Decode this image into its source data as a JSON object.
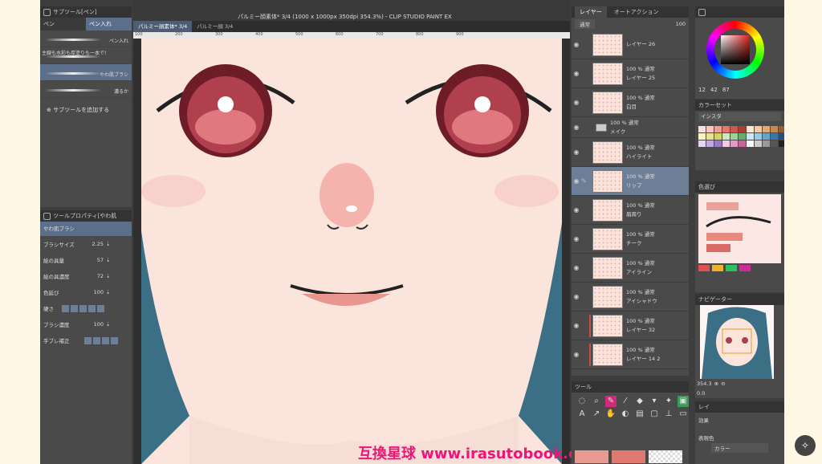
{
  "subtool": {
    "header": "サブツール[ペン]",
    "tabs": [
      "ペン",
      "ペン入れ"
    ],
    "brushes": [
      {
        "label": "ペン入れ"
      },
      {
        "label": "主線も水彩も厚塗りも一本で!"
      },
      {
        "label": "やわ肌ブラシ"
      },
      {
        "label": "濃るか"
      }
    ],
    "add": "サブツールを追加する"
  },
  "toolprop": {
    "header": "ツールプロパティ[やわ肌",
    "brush": "やわ肌ブラシ",
    "rows": [
      {
        "label": "ブラシサイズ",
        "value": "2.25"
      },
      {
        "label": "絵の具量",
        "value": "57"
      },
      {
        "label": "絵の具濃度",
        "value": "72"
      },
      {
        "label": "色延び",
        "value": "100"
      },
      {
        "label": "硬さ",
        "value": ""
      },
      {
        "label": "ブラシ濃度",
        "value": "100"
      },
      {
        "label": "手ブレ補正",
        "value": ""
      }
    ]
  },
  "canvas": {
    "title": "パルミー顔素体* 3/4 (1000 x 1000px 350dpi 354.3%) - CLIP STUDIO PAINT EX",
    "tabs": [
      "パルミー顔素体* 3/4",
      "パルミー顔 3/4"
    ],
    "ruler": [
      "100",
      "200",
      "300",
      "400",
      "500",
      "600",
      "700",
      "800",
      "900"
    ]
  },
  "watermark": "互換星球 www.irasutobook.com",
  "layers": {
    "header": "レイヤー",
    "header2": "オートアクション",
    "blend": "通常",
    "opacity": "100",
    "items": [
      {
        "pct": "",
        "name": "レイヤー 26",
        "sel": false,
        "folder": false
      },
      {
        "pct": "100 % 通常",
        "name": "レイヤー 25",
        "sel": false,
        "folder": false
      },
      {
        "pct": "100 % 通常",
        "name": "白目",
        "sel": false,
        "folder": false
      },
      {
        "pct": "100 % 通常",
        "name": "メイク",
        "sel": false,
        "folder": true
      },
      {
        "pct": "100 % 通常",
        "name": "ハイライト",
        "sel": false,
        "folder": false
      },
      {
        "pct": "100 % 通常",
        "name": "リップ",
        "sel": true,
        "folder": false
      },
      {
        "pct": "100 % 通常",
        "name": "眉周り",
        "sel": false,
        "folder": false
      },
      {
        "pct": "100 % 通常",
        "name": "チーク",
        "sel": false,
        "folder": false
      },
      {
        "pct": "100 % 通常",
        "name": "アイライン",
        "sel": false,
        "folder": false
      },
      {
        "pct": "100 % 通常",
        "name": "アイシャドウ",
        "sel": false,
        "folder": false
      },
      {
        "pct": "100 % 通常",
        "name": "レイヤー 32",
        "sel": false,
        "folder": false
      },
      {
        "pct": "100 % 通常",
        "name": "レイヤー 14 2",
        "sel": false,
        "folder": false
      }
    ]
  },
  "tools": {
    "header": "ツール"
  },
  "colorwheel": {
    "h": "12",
    "s": "42",
    "v": "87"
  },
  "colorset": {
    "header": "カラーセット",
    "dropdown": "インスタ"
  },
  "reference": {
    "header": "色選び"
  },
  "navigator": {
    "header": "ナビゲーター",
    "zoom": "354.3",
    "angle": "0.0"
  },
  "effect": {
    "header": "レイ",
    "label": "効果",
    "color_label": "表現色",
    "color_value": "カラー"
  }
}
